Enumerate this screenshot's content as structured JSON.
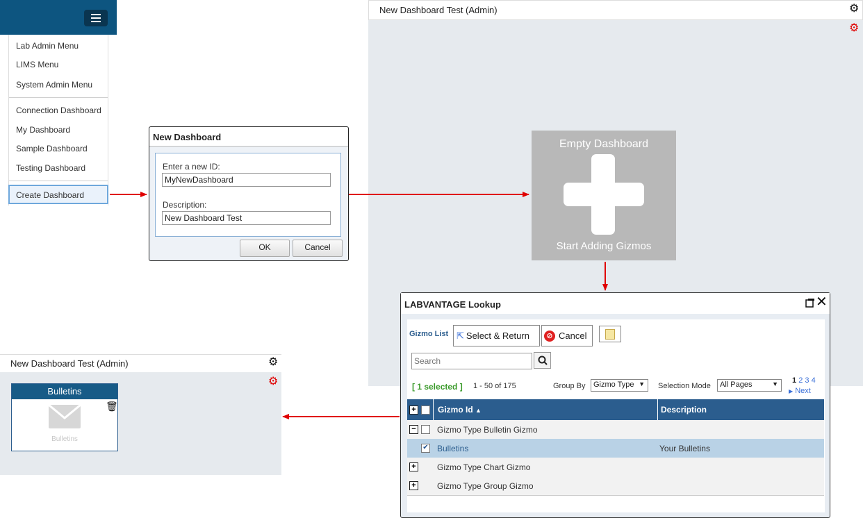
{
  "menu": {
    "items": [
      "Lab Admin Menu",
      "LIMS Menu",
      "System Admin Menu",
      "Connection Dashboard",
      "My Dashboard",
      "Sample Dashboard",
      "Testing Dashboard"
    ],
    "create_label": "Create Dashboard"
  },
  "new_dashboard_dialog": {
    "title": "New Dashboard",
    "id_label": "Enter a new ID:",
    "id_value": "MyNewDashboard",
    "desc_label": "Description:",
    "desc_value": "New Dashboard Test",
    "ok_label": "OK",
    "cancel_label": "Cancel"
  },
  "dashboard_right": {
    "title": "New Dashboard Test (Admin)",
    "empty_title": "Empty Dashboard",
    "empty_subtitle": "Start Adding Gizmos"
  },
  "lookup": {
    "title": "LABVANTAGE Lookup",
    "list_label": "Gizmo List",
    "select_return_label": "Select & Return",
    "cancel_label": "Cancel",
    "search_placeholder": "Search",
    "selected_text": "[ 1 selected ]",
    "range_text": "1 - 50 of 175",
    "group_by_label": "Group By",
    "group_by_value": "Gizmo Type",
    "selection_mode_label": "Selection Mode",
    "selection_mode_value": "All Pages",
    "pages": [
      "1",
      "2",
      "3",
      "4"
    ],
    "next_label": "Next",
    "columns": [
      "Gizmo Id",
      "Description"
    ],
    "rows": [
      {
        "label": "Gizmo Type Bulletin Gizmo"
      },
      {
        "id": "Bulletins",
        "description": "Your Bulletins"
      },
      {
        "label": "Gizmo Type Chart Gizmo"
      },
      {
        "label": "Gizmo Type Group Gizmo"
      }
    ]
  },
  "dashboard_left": {
    "title": "New Dashboard Test (Admin)",
    "tile_title": "Bulletins",
    "tile_caption": "Bulletins"
  },
  "colors": {
    "topbar": "#0d5580",
    "grid_header": "#2b5d8e",
    "arrow": "#e00000",
    "selected_green": "#3a9a2a",
    "selected_row": "#b9d2e6",
    "gear_red": "#e00000"
  },
  "icons": [
    "hamburger-icon",
    "gear-icon",
    "plus-icon",
    "select-cursor-icon",
    "cancel-icon",
    "note-icon",
    "search-icon",
    "maximize-icon",
    "close-icon",
    "envelope-icon",
    "trash-icon",
    "sort-up-icon",
    "expand-icon",
    "collapse-icon",
    "checkbox"
  ]
}
